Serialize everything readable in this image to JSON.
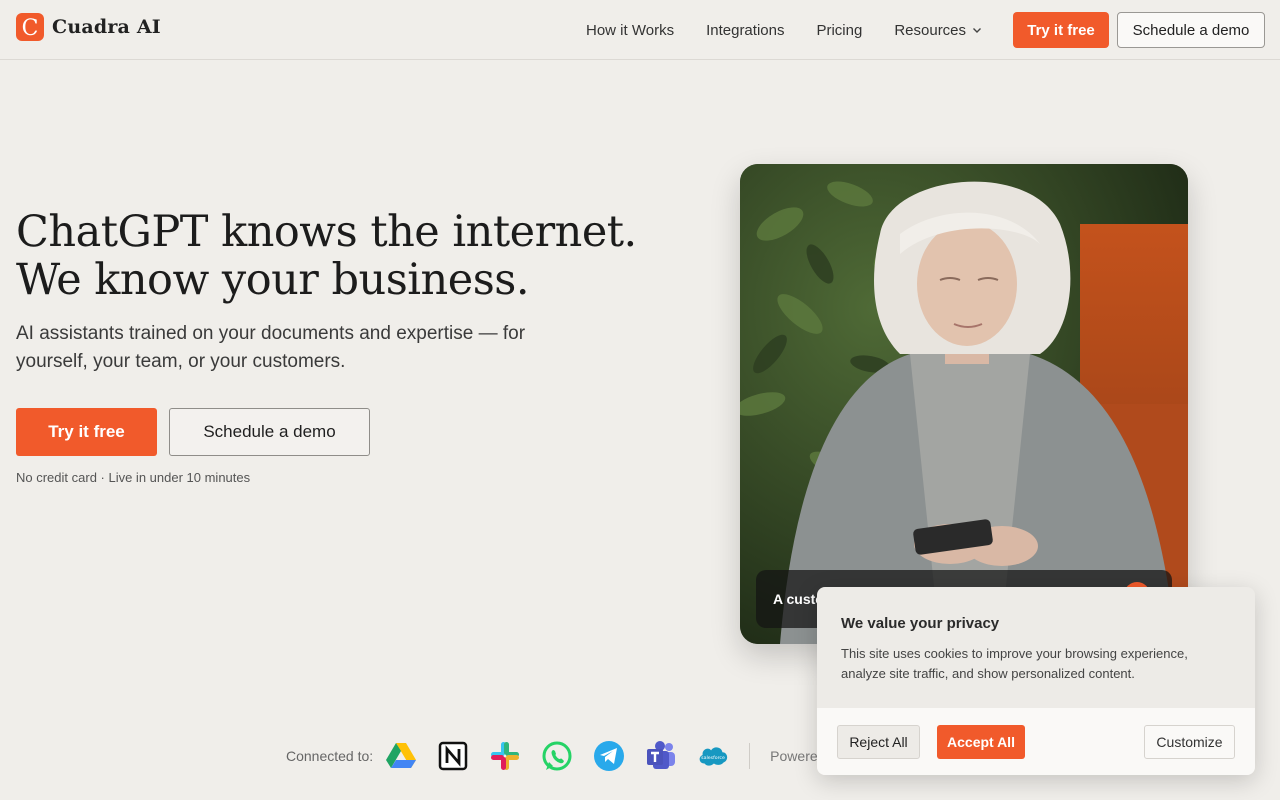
{
  "brand": {
    "name": "Cuadra AI",
    "logo_letter": "C",
    "accent": "#f15a2b"
  },
  "nav": {
    "links": [
      "How it Works",
      "Integrations",
      "Pricing",
      "Resources"
    ],
    "try_label": "Try it free",
    "demo_label": "Schedule a demo"
  },
  "hero": {
    "title_line1": "ChatGPT knows the internet.",
    "title_line2": "We know your business.",
    "subtitle": "AI assistants trained on your documents and expertise — for yourself, your team, or your customers.",
    "primary_cta": "Try it free",
    "secondary_cta": "Schedule a demo",
    "note": "No credit card · Live in under 10 minutes"
  },
  "video": {
    "caption": "A custo"
  },
  "connected": {
    "label": "Connected to:",
    "integrations": [
      "google-drive-icon",
      "notion-icon",
      "slack-icon",
      "whatsapp-icon",
      "telegram-icon",
      "teams-icon",
      "salesforce-icon"
    ],
    "powered_label": "Powere"
  },
  "cookie": {
    "title": "We value your privacy",
    "text": "This site uses cookies to improve your browsing experience, analyze site traffic, and show personalized content.",
    "reject": "Reject All",
    "accept": "Accept All",
    "customize": "Customize"
  }
}
